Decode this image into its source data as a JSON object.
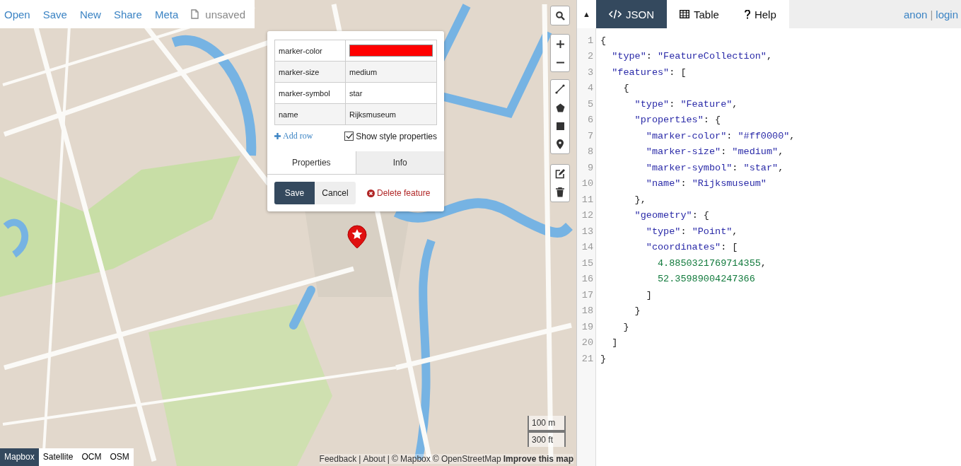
{
  "top_menu": {
    "items": [
      {
        "label": "Open"
      },
      {
        "label": "Save"
      },
      {
        "label": "New"
      },
      {
        "label": "Share"
      },
      {
        "label": "Meta"
      }
    ],
    "file_status": "unsaved"
  },
  "popup": {
    "rows": [
      {
        "key": "marker-color",
        "kind": "color",
        "color": "#ff0000"
      },
      {
        "key": "marker-size",
        "kind": "text",
        "value": "medium"
      },
      {
        "key": "marker-symbol",
        "kind": "text",
        "value": "star"
      },
      {
        "key": "name",
        "kind": "text",
        "value": "Rijksmuseum"
      }
    ],
    "add_row": "Add row",
    "show_style": {
      "label": "Show style properties",
      "checked": true
    },
    "tabs": [
      {
        "label": "Properties",
        "selected": true
      },
      {
        "label": "Info",
        "selected": false
      }
    ],
    "buttons": {
      "save": "Save",
      "cancel": "Cancel",
      "delete": "Delete feature"
    }
  },
  "layers": [
    {
      "label": "Mapbox",
      "selected": true
    },
    {
      "label": "Satellite",
      "selected": false
    },
    {
      "label": "OCM",
      "selected": false
    },
    {
      "label": "OSM",
      "selected": false
    }
  ],
  "scale": [
    "100 m",
    "300 ft"
  ],
  "attribution": [
    {
      "kind": "link",
      "text": "Feedback"
    },
    {
      "kind": "sep",
      "text": "|"
    },
    {
      "kind": "link",
      "text": "About"
    },
    {
      "kind": "sep",
      "text": "|"
    },
    {
      "kind": "link",
      "text": "© Mapbox"
    },
    {
      "kind": "link",
      "text": "© OpenStreetMap"
    },
    {
      "kind": "strong",
      "text": "Improve this map"
    }
  ],
  "panel": {
    "collapse": "▲",
    "tabs": [
      {
        "label": "JSON",
        "selected": true
      },
      {
        "label": "Table",
        "selected": false
      },
      {
        "label": "Help",
        "selected": false
      }
    ],
    "user": "anon",
    "user_sep": "|",
    "login": "login"
  },
  "editor": {
    "line_numbers": [
      "1",
      "2",
      "3",
      "4",
      "5",
      "6",
      "7",
      "8",
      "9",
      "10",
      "11",
      "12",
      "13",
      "14",
      "15",
      "16",
      "17",
      "18",
      "19",
      "20",
      "21"
    ],
    "lines": [
      "{",
      "  \"type\": \"FeatureCollection\",",
      "  \"features\": [",
      "    {",
      "      \"type\": \"Feature\",",
      "      \"properties\": {",
      "        \"marker-color\": \"#ff0000\",",
      "        \"marker-size\": \"medium\",",
      "        \"marker-symbol\": \"star\",",
      "        \"name\": \"Rijksmuseum\"",
      "      },",
      "      \"geometry\": {",
      "        \"type\": \"Point\",",
      "        \"coordinates\": [",
      "          4.8850321769714355,",
      "          52.35989004247366",
      "        ]",
      "      }",
      "    }",
      "  ]",
      "}"
    ]
  }
}
